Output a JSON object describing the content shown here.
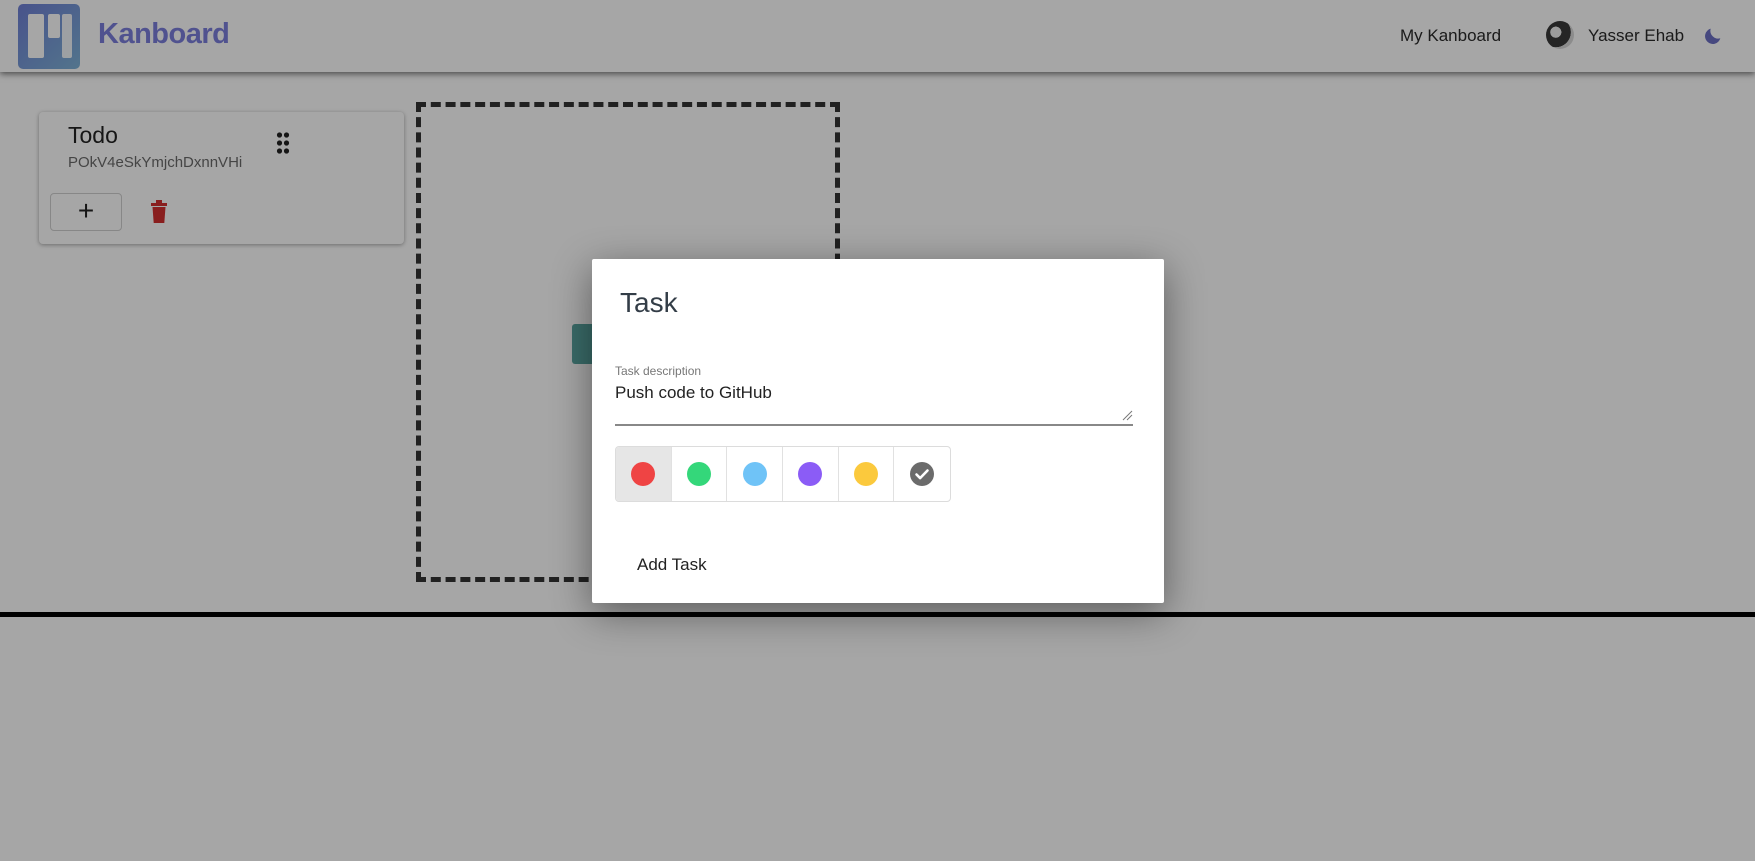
{
  "header": {
    "app_name": "Kanboard",
    "nav_link": "My Kanboard",
    "user_name": "Yasser Ehab"
  },
  "board": {
    "columns": [
      {
        "title": "Todo",
        "id": "POkV4eSkYmjchDxnnVHi",
        "add_label": "+"
      }
    ]
  },
  "dialog": {
    "title": "Task",
    "description_label": "Task description",
    "description_value": "Push code to GitHub",
    "colors": [
      {
        "name": "red",
        "hex": "#ef4444",
        "selected": true
      },
      {
        "name": "green",
        "hex": "#34d77a",
        "selected": false
      },
      {
        "name": "blue",
        "hex": "#6fc3f7",
        "selected": false
      },
      {
        "name": "purple",
        "hex": "#8b5cf6",
        "selected": false
      },
      {
        "name": "yellow",
        "hex": "#fbc93d",
        "selected": false
      },
      {
        "name": "check",
        "hex": "#6b6b6b",
        "selected": false
      }
    ],
    "submit_label": "Add Task"
  },
  "colors": {
    "brand": "#7c7fdc",
    "danger": "#d32f2f",
    "overlay": "rgba(0,0,0,0.35)"
  }
}
